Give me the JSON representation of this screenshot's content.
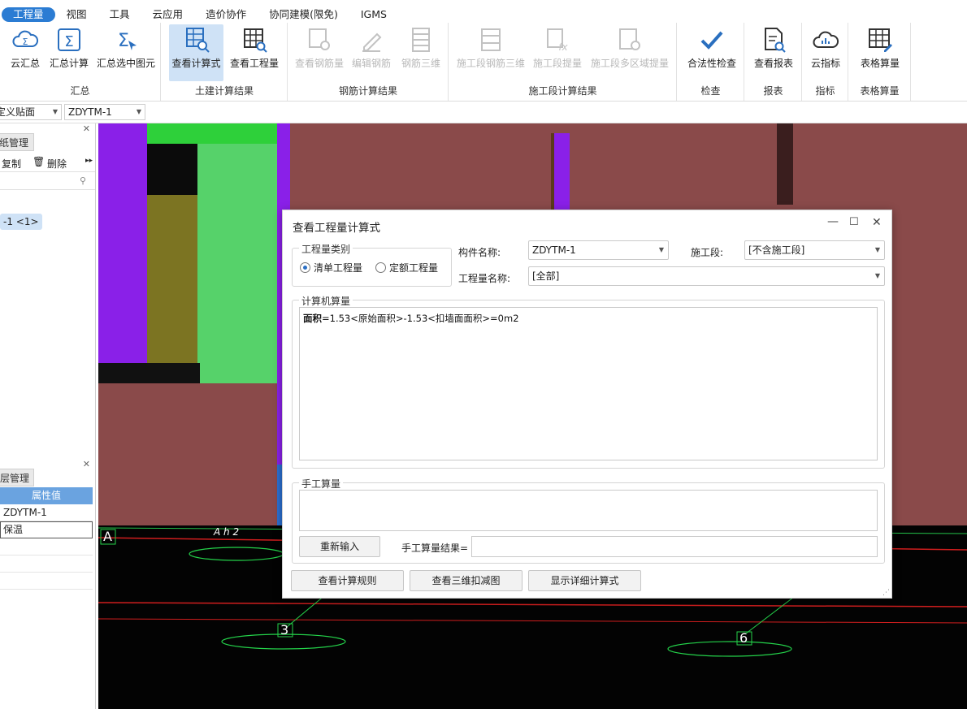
{
  "menu": {
    "items": [
      "工程量",
      "视图",
      "工具",
      "云应用",
      "造价协作",
      "协同建模(限免)",
      "IGMS"
    ]
  },
  "ribbon": {
    "groups": [
      {
        "label": "汇总",
        "buttons": [
          "云汇总",
          "汇总计算",
          "汇总选中图元"
        ]
      },
      {
        "label": "土建计算结果",
        "buttons": [
          "查看计算式",
          "查看工程量"
        ]
      },
      {
        "label": "钢筋计算结果",
        "buttons": [
          "查看钢筋量",
          "编辑钢筋",
          "钢筋三维"
        ]
      },
      {
        "label": "施工段计算结果",
        "buttons": [
          "施工段钢筋三维",
          "施工段提量",
          "施工段多区域提量"
        ]
      },
      {
        "label": "检查",
        "buttons": [
          "合法性检查"
        ]
      },
      {
        "label": "报表",
        "buttons": [
          "查看报表"
        ]
      },
      {
        "label": "指标",
        "buttons": [
          "云指标"
        ]
      },
      {
        "label": "表格算量",
        "buttons": [
          "表格算量"
        ]
      }
    ]
  },
  "selector": {
    "combo1": "定义贴面",
    "combo2": "ZDYTM-1"
  },
  "leftpanel": {
    "tab1": "纸管理",
    "copy": "复制",
    "delete": "删除",
    "tree_item": "-1 <1>",
    "tab2": "层管理",
    "prop_header": "属性值",
    "prop_rows": [
      "ZDYTM-1",
      "保温"
    ]
  },
  "cad": {
    "axis_a": "A",
    "axis_3": "3",
    "axis_6": "6",
    "ah": "A h 2"
  },
  "dialog": {
    "title": "查看工程量计算式",
    "qty_type_legend": "工程量类别",
    "radio_list": "清单工程量",
    "radio_quota": "定额工程量",
    "component_label": "构件名称:",
    "component_value": "ZDYTM-1",
    "section_label": "施工段:",
    "section_value": "[不含施工段]",
    "qtyname_label": "工程量名称:",
    "qtyname_value": "[全部]",
    "computer_legend": "计算机算量",
    "formula_bold": "面积",
    "formula_rest": "=1.53<原始面积>-1.53<扣墙面面积>=0m2",
    "manual_legend": "手工算量",
    "reenter": "重新输入",
    "manual_result_label": "手工算量结果=",
    "btn_rules": "查看计算规则",
    "btn_3d": "查看三维扣减图",
    "btn_detail": "显示详细计算式"
  }
}
